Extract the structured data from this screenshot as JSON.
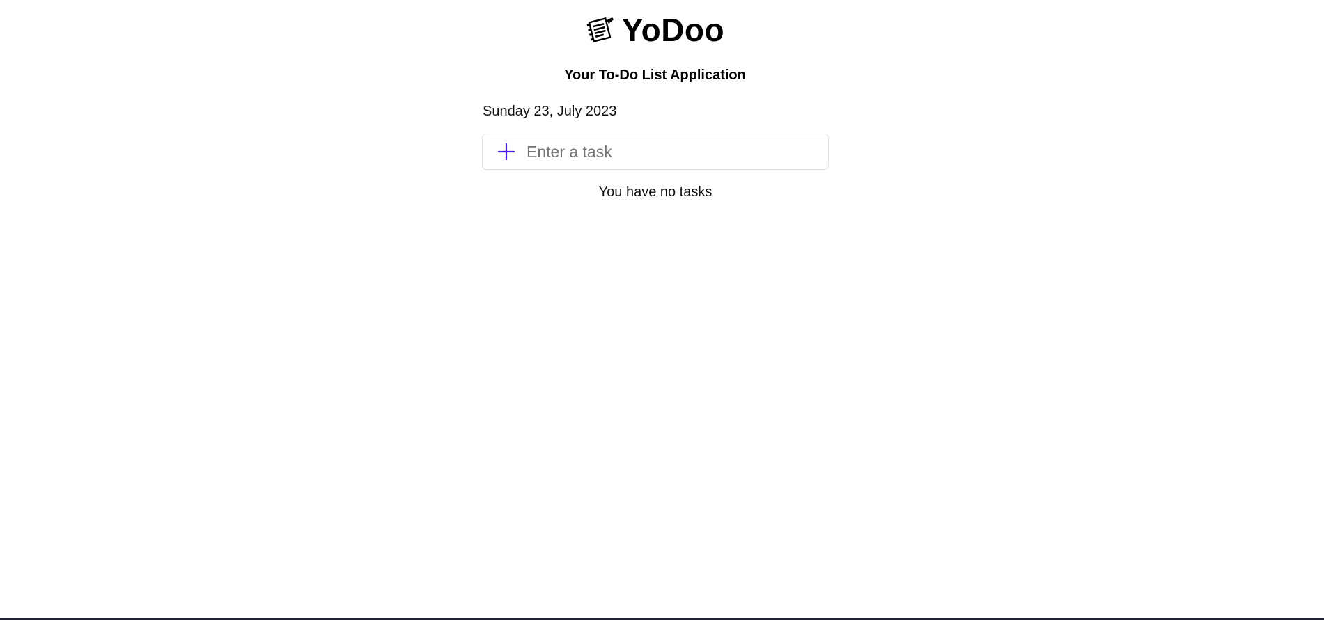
{
  "header": {
    "logo_icon": "notepad-pencil-icon",
    "app_name": "YoDoo",
    "tagline": "Your To-Do List Application"
  },
  "main": {
    "date": "Sunday 23, July 2023",
    "task_input": {
      "placeholder": "Enter a task",
      "value": "",
      "add_icon": "plus-icon"
    },
    "empty_message": "You have no tasks"
  },
  "colors": {
    "accent": "#4b1fe0",
    "input_border": "#e3e3e6",
    "text": "#111111",
    "bottom_bar": "#232336"
  }
}
